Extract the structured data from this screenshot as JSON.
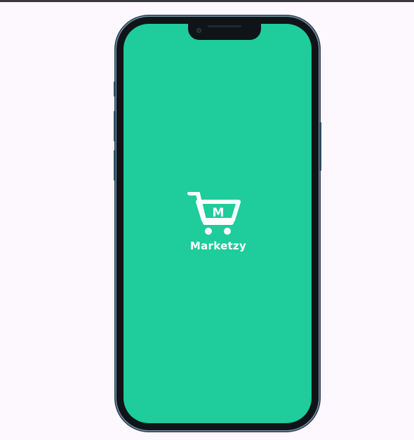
{
  "app": {
    "name": "Marketzy",
    "logo_letter": "M"
  },
  "icons": {
    "logo": "shopping-cart-icon",
    "camera": "front-camera-icon"
  },
  "colors": {
    "splash_background": "#1ecc9c",
    "logo": "#ffffff",
    "page_background": "#fdf7fe",
    "phone_frame": "#101417"
  }
}
